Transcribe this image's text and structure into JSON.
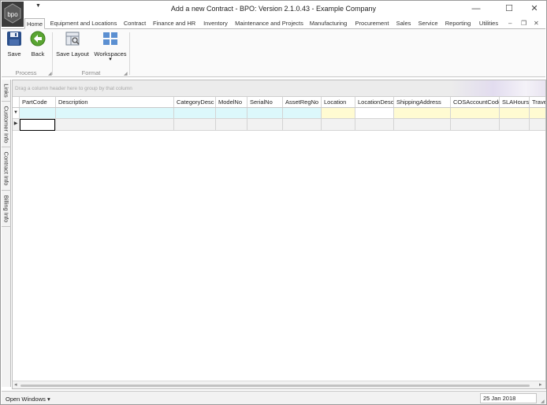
{
  "window": {
    "title": "Add a new Contract - BPO: Version 2.1.0.43 - Example Company",
    "qat_arrow": "▼",
    "logo_text": "bpo",
    "minimize": "—",
    "maximize": "☐",
    "close": "✕"
  },
  "tabs": [
    {
      "label": "Home",
      "active": true
    },
    {
      "label": "Equipment and Locations"
    },
    {
      "label": "Contract"
    },
    {
      "label": "Finance and HR"
    },
    {
      "label": "Inventory"
    },
    {
      "label": "Maintenance and Projects"
    },
    {
      "label": "Manufacturing"
    },
    {
      "label": "Procurement"
    },
    {
      "label": "Sales"
    },
    {
      "label": "Service"
    },
    {
      "label": "Reporting"
    },
    {
      "label": "Utilities"
    }
  ],
  "mdi": {
    "minimize": "–",
    "restore": "❐",
    "close": "✕"
  },
  "ribbon": {
    "save_label": "Save",
    "back_label": "Back",
    "save_layout_label": "Save Layout",
    "workspaces_label": "Workspaces",
    "workspaces_arrow": "▾",
    "process_group": "Process",
    "format_group": "Format",
    "launcher": "◢"
  },
  "side_tabs": [
    "Links",
    "Customer Info",
    "Contract Info",
    "Billing Info"
  ],
  "grid": {
    "group_hint": "Drag a column header here to group by that column",
    "columns": [
      "PartCode",
      "Description",
      "CategoryDesc",
      "ModelNo",
      "SerialNo",
      "AssetRegNo",
      "Location",
      "LocationDesc",
      "ShippingAddress",
      "COSAccountCode",
      "SLAHours",
      "TravelTime"
    ],
    "filter_indicator": "▼",
    "row_indicator": "▶",
    "scroll_left": "◂",
    "scroll_right": "▸"
  },
  "colors": {
    "filter_cyan": "#dcf8fb",
    "filter_yellow": "#fffbd2",
    "save_icon": "#2b4f8a",
    "back_icon": "#5aa532",
    "workspace_icon": "#5b8fd1"
  },
  "status": {
    "open_windows": "Open Windows ▾",
    "date": "25 Jan 2018",
    "grip": "◢"
  }
}
